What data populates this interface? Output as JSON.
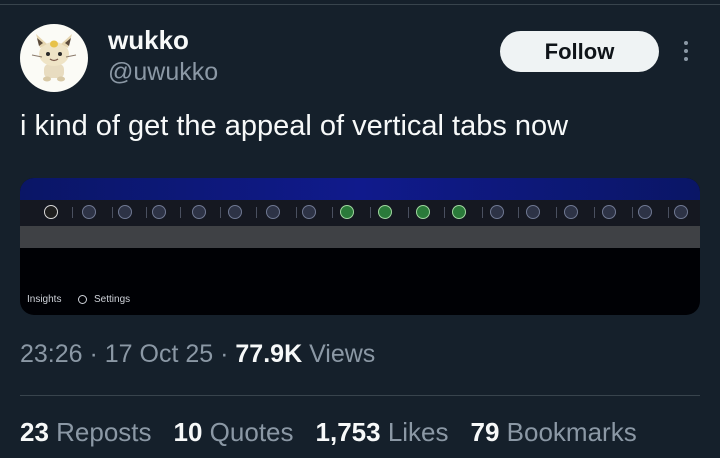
{
  "author": {
    "display_name": "wukko",
    "handle": "@uwukko",
    "avatar_icon": "meowth-avatar-icon"
  },
  "actions": {
    "follow_label": "Follow",
    "more_icon": "more-options-icon"
  },
  "tweet": {
    "text": "i kind of get the appeal of vertical tabs now"
  },
  "media": {
    "insights_label": "Insights",
    "settings_label": "Settings"
  },
  "meta": {
    "time": "23:26",
    "sep1": " · ",
    "date": "17 Oct 25",
    "sep2": " · ",
    "views_count": "77.9K",
    "views_label": " Views"
  },
  "stats": {
    "reposts_count": "23",
    "reposts_label": " Reposts",
    "quotes_count": "10",
    "quotes_label": " Quotes",
    "likes_count": "1,753",
    "likes_label": " Likes",
    "bookmarks_count": "79",
    "bookmarks_label": " Bookmarks"
  },
  "colors": {
    "background": "#15202b",
    "text_primary": "#f7f9f9",
    "text_secondary": "#8b98a5",
    "follow_bg": "#eff3f4"
  }
}
